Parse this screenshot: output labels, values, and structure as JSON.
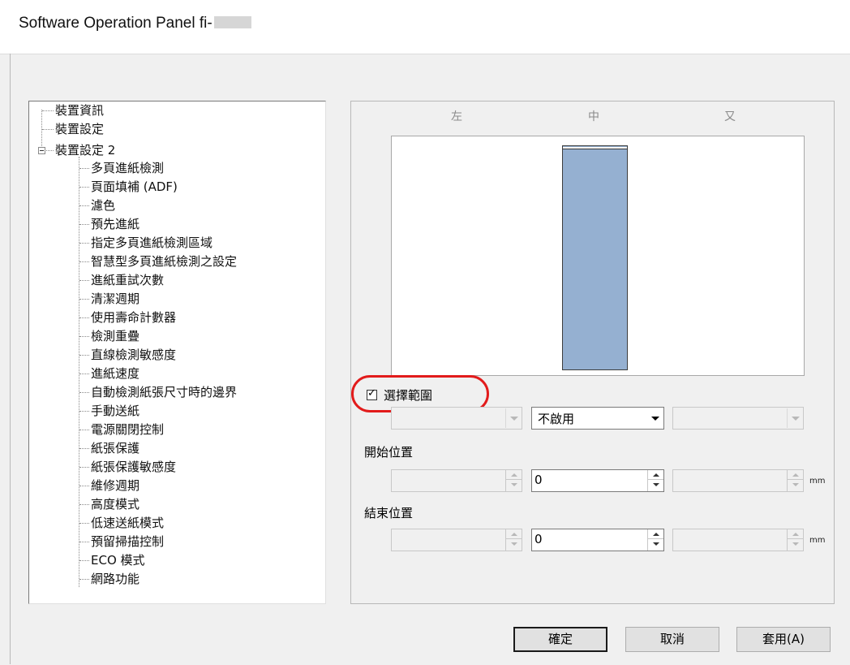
{
  "window": {
    "title": "Software Operation Panel fi-"
  },
  "tree": {
    "items": [
      "裝置資訊",
      "裝置設定",
      "裝置設定 2",
      "多頁進紙檢測",
      "頁面填補 (ADF)",
      "濾色",
      "預先進紙",
      "指定多頁進紙檢測區域",
      "智慧型多頁進紙檢測之設定",
      "進紙重試次數",
      "清潔週期",
      "使用壽命計數器",
      "檢測重疊",
      "直線檢測敏感度",
      "進紙速度",
      "自動檢測紙張尺寸時的邊界",
      "手動送紙",
      "電源關閉控制",
      "紙張保護",
      "紙張保護敏感度",
      "維修週期",
      "高度模式",
      "低速送紙模式",
      "預留掃描控制",
      "ECO 模式",
      "網路功能"
    ]
  },
  "panel": {
    "col_left": "左",
    "col_center": "中",
    "col_right": "又",
    "checkbox_label": "選擇範圍",
    "checkbox_checked": true,
    "combo_left": "",
    "combo_center": "不啟用",
    "combo_right": "",
    "start_label": "開始位置",
    "end_label": "結束位置",
    "start_left": "",
    "start_center": "0",
    "start_right": "",
    "end_left": "",
    "end_center": "0",
    "end_right": "",
    "unit": "mm"
  },
  "buttons": {
    "ok": "確定",
    "cancel": "取消",
    "apply": "套用(A)"
  },
  "colors": {
    "highlight": "#e21b1b",
    "paper_fill": "#95b0d1"
  }
}
